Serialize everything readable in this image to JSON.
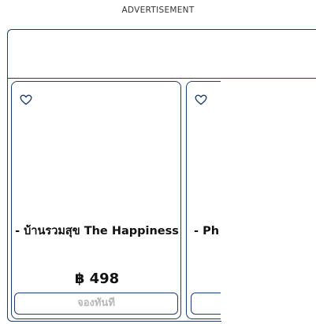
{
  "ad": {
    "label": "ADVERTISEMENT"
  },
  "products": [
    {
      "title": "- บ้านรวมสุข The Happiness",
      "price": "฿ 498",
      "button": "จองทันที",
      "favorite_icon": "heart-outline-icon"
    },
    {
      "title": "- Ph",
      "favorite_icon": "heart-outline-icon"
    }
  ],
  "colors": {
    "border": "#1e3d6b",
    "button_text": "#b7b7b7"
  }
}
